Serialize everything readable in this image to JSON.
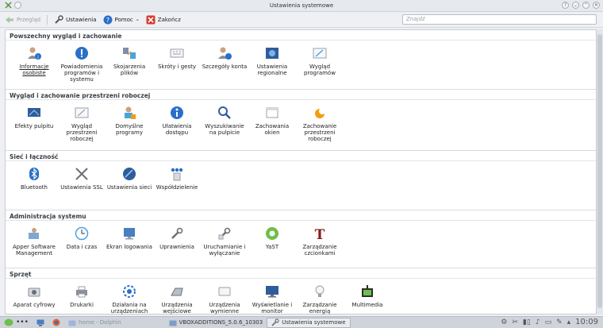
{
  "window": {
    "title": "Ustawienia systemowe"
  },
  "toolbar": {
    "back_label": "Przegląd",
    "settings_label": "Ustawienia",
    "help_label": "Pomoc",
    "quit_label": "Zakończ",
    "search_placeholder": "Znajdź"
  },
  "sections": [
    {
      "title": "Powszechny wygląd i zachowanie",
      "items": [
        "Informacje osobiste",
        "Powiadomienia programów i systemu",
        "Skojarzenia plików",
        "Skróty i gesty",
        "Szczegóły konta",
        "Ustawienia regionalne",
        "Wygląd programów"
      ]
    },
    {
      "title": "Wygląd i zachowanie przestrzeni roboczej",
      "items": [
        "Efekty pulpitu",
        "Wygląd przestrzeni roboczej",
        "Domyślne programy",
        "Ułatwienia dostępu",
        "Wyszukiwanie na pulpicie",
        "Zachowania okien",
        "Zachowanie przestrzeni roboczej"
      ]
    },
    {
      "title": "Sieć i łączność",
      "items": [
        "Bluetooth",
        "Ustawienia SSL",
        "Ustawienia sieci",
        "Współdzielenie"
      ]
    },
    {
      "title": "Administracja systemu",
      "items": [
        "Apper Software Management",
        "Data i czas",
        "Ekran logowania",
        "Uprawnienia",
        "Uruchamianie i wyłączanie",
        "YaST",
        "Zarządzanie czcionkami"
      ]
    },
    {
      "title": "Sprzęt",
      "items": [
        "Aparat cyfrowy",
        "Drukarki",
        "Działania na urządzeniach",
        "Urządzenia wejściowe",
        "Urządzenia wymienne",
        "Wyświetlanie i monitor",
        "Zarządzanie energią",
        "Multimedia"
      ]
    }
  ],
  "taskbar": {
    "task1": "home - Dolphin",
    "task2": "VBOXADDITIONS_5.0.6_10303",
    "task3": "Ustawienia systemowe",
    "clock": "10:09"
  },
  "colors": {
    "accent": "#2a6fc9",
    "link": "#222222"
  }
}
